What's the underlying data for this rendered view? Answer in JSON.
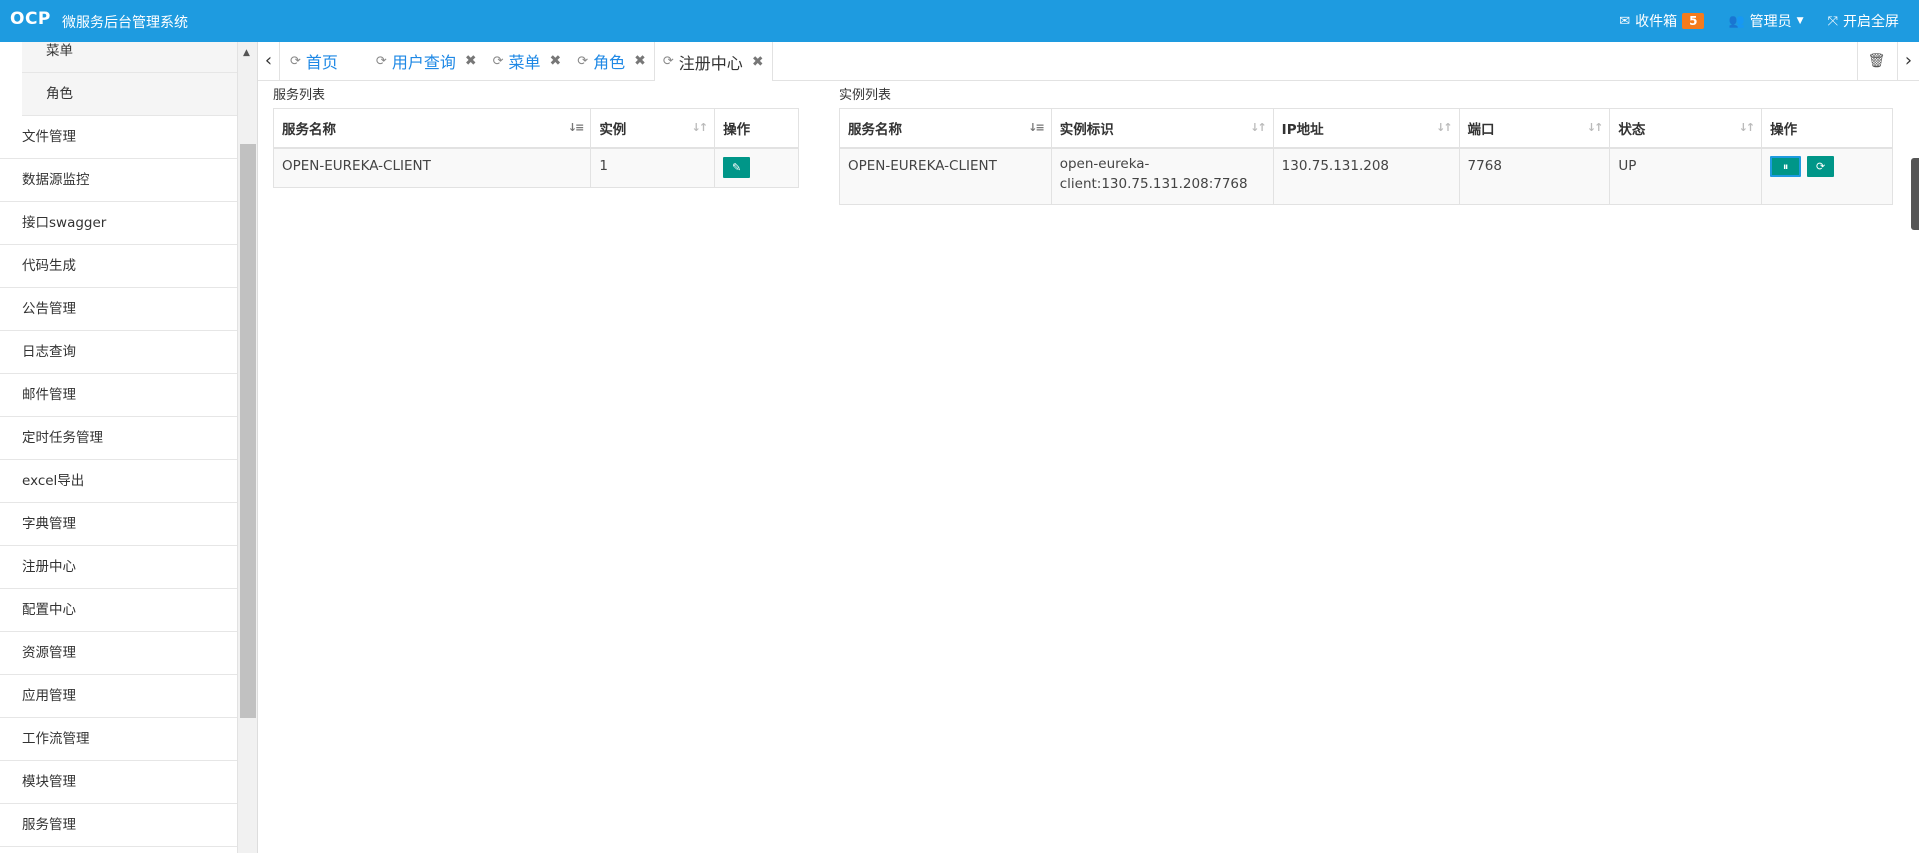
{
  "header": {
    "logo": "OCP",
    "title": "微服务后台管理系统",
    "inbox_label": "收件箱",
    "inbox_count": "5",
    "user_label": "管理员",
    "fullscreen_label": "开启全屏"
  },
  "sidebar": {
    "sub_items": [
      "菜单",
      "角色"
    ],
    "items": [
      "文件管理",
      "数据源监控",
      "接口swagger",
      "代码生成",
      "公告管理",
      "日志查询",
      "邮件管理",
      "定时任务管理",
      "excel导出",
      "字典管理",
      "注册中心",
      "配置中心",
      "资源管理",
      "应用管理",
      "工作流管理",
      "模块管理",
      "服务管理"
    ]
  },
  "tabs": [
    {
      "label": "首页",
      "closable": false
    },
    {
      "label": "用户查询",
      "closable": true
    },
    {
      "label": "菜单",
      "closable": true
    },
    {
      "label": "角色",
      "closable": true
    },
    {
      "label": "注册中心",
      "closable": true,
      "active": true
    }
  ],
  "services": {
    "title": "服务列表",
    "columns": [
      "服务名称",
      "实例",
      "操作"
    ],
    "rows": [
      {
        "name": "OPEN-EUREKA-CLIENT",
        "instances": "1"
      }
    ]
  },
  "instances": {
    "title": "实例列表",
    "columns": [
      "服务名称",
      "实例标识",
      "IP地址",
      "端口",
      "状态",
      "操作"
    ],
    "rows": [
      {
        "name": "OPEN-EUREKA-CLIENT",
        "id_line1": "open-eureka-",
        "id_line2": "client:130.75.131.208:7768",
        "ip": "130.75.131.208",
        "port": "7768",
        "status": "UP"
      }
    ]
  },
  "colors": {
    "header_bg": "#1e9be0",
    "badge": "#f37b1d",
    "action_button": "#009688"
  }
}
